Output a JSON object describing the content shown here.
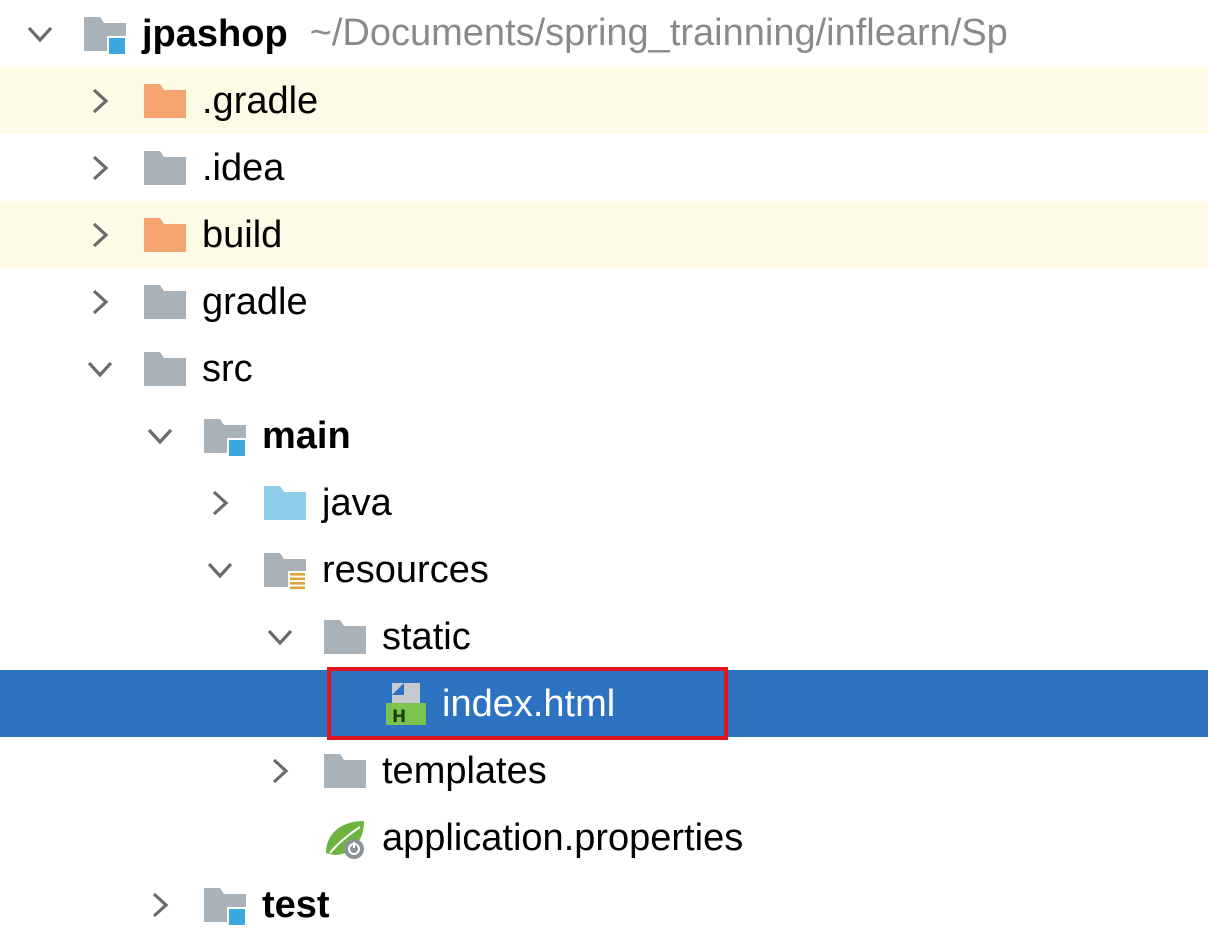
{
  "project": {
    "name": "jpashop",
    "path": "~/Documents/spring_trainning/inflearn/Sp"
  },
  "items": [
    {
      "label": ".gradle",
      "expanded": false,
      "icon": "folder-excluded-icon"
    },
    {
      "label": ".idea",
      "expanded": false,
      "icon": "folder-icon"
    },
    {
      "label": "build",
      "expanded": false,
      "icon": "folder-excluded-icon"
    },
    {
      "label": "gradle",
      "expanded": false,
      "icon": "folder-icon"
    },
    {
      "label": "src",
      "expanded": true,
      "icon": "folder-icon"
    },
    {
      "label": "main",
      "expanded": true,
      "icon": "module-folder-icon"
    },
    {
      "label": "java",
      "expanded": false,
      "icon": "source-folder-icon"
    },
    {
      "label": "resources",
      "expanded": true,
      "icon": "resources-folder-icon"
    },
    {
      "label": "static",
      "expanded": true,
      "icon": "folder-icon"
    },
    {
      "label": "index.html",
      "icon": "html-file-icon",
      "selected": true
    },
    {
      "label": "templates",
      "expanded": false,
      "icon": "folder-icon"
    },
    {
      "label": "application.properties",
      "icon": "spring-properties-icon"
    },
    {
      "label": "test",
      "expanded": false,
      "icon": "module-folder-icon"
    }
  ],
  "colors": {
    "selection": "#2d73c2",
    "excluded_row": "#fdfbe6",
    "excluded_folder": "#f4a46e",
    "folder": "#aab2b9",
    "source_folder": "#8ecde9",
    "module_badge": "#3aa8df",
    "highlight_border": "#e0141c"
  }
}
